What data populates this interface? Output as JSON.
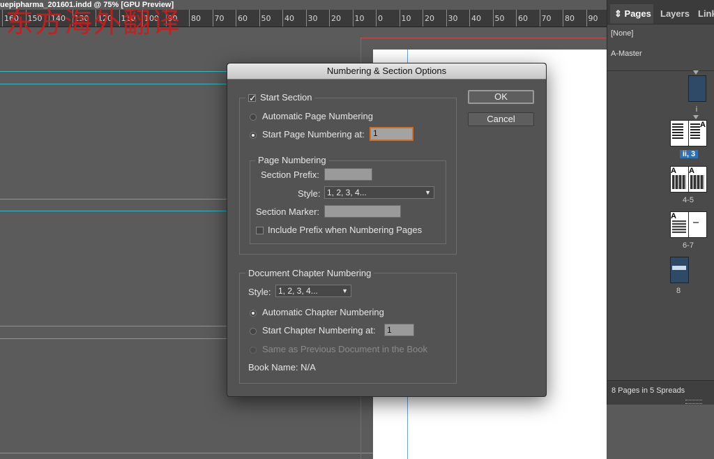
{
  "document": {
    "title": "uepipharma_201601.indd @ 75% [GPU Preview]",
    "watermark": "东方海外翻译"
  },
  "ruler": {
    "ticks": [
      "160",
      "150",
      "140",
      "130",
      "120",
      "110",
      "100",
      "90",
      "80",
      "70",
      "60",
      "50",
      "40",
      "30",
      "20",
      "10",
      "0",
      "10",
      "20",
      "30",
      "40",
      "50",
      "60",
      "70",
      "80",
      "90"
    ]
  },
  "pages_panel": {
    "tabs": [
      "Pages",
      "Layers",
      "Link"
    ],
    "masters": [
      "[None]",
      "A-Master"
    ],
    "spreads": [
      "i",
      "ii, 3",
      "4-5",
      "6-7",
      "8"
    ],
    "footer": "8 Pages in 5 Spreads",
    "thumb_letter": "A"
  },
  "dialog": {
    "title": "Numbering & Section Options",
    "ok_label": "OK",
    "cancel_label": "Cancel",
    "start_section": {
      "label": "Start Section",
      "checked": true
    },
    "auto_page_numbering": "Automatic Page Numbering",
    "start_page_numbering": {
      "label": "Start Page Numbering at:",
      "value": "1"
    },
    "page_numbering": {
      "legend": "Page Numbering",
      "section_prefix_label": "Section Prefix:",
      "section_prefix_value": "",
      "style_label": "Style:",
      "style_value": "1, 2, 3, 4...",
      "section_marker_label": "Section Marker:",
      "section_marker_value": "",
      "include_prefix_label": "Include Prefix when Numbering Pages",
      "include_prefix_checked": false
    },
    "chapter": {
      "legend": "Document Chapter Numbering",
      "style_label": "Style:",
      "style_value": "1, 2, 3, 4...",
      "auto_chapter": "Automatic Chapter Numbering",
      "start_chapter_label": "Start Chapter Numbering at:",
      "start_chapter_value": "1",
      "same_as_previous": "Same as Previous Document in the Book",
      "book_name": "Book Name: N/A"
    }
  }
}
